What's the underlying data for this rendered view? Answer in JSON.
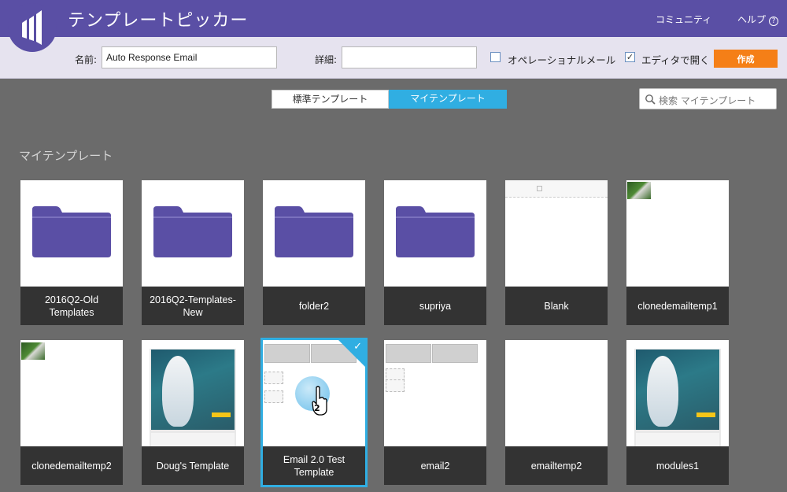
{
  "header": {
    "title": "テンプレートピッカー",
    "community_label": "コミュニティ",
    "help_label": "ヘルプ",
    "help_icon_glyph": "?"
  },
  "form": {
    "name_label": "名前:",
    "name_value": "Auto Response Email",
    "details_label": "詳細:",
    "details_value": "",
    "operational_label": "オペレーショナルメール",
    "operational_checked": false,
    "open_editor_label": "エディタで開く",
    "open_editor_checked": true,
    "checkbox_checked_glyph": "✓",
    "create_label": "作成"
  },
  "tabs": [
    {
      "label": "標準テンプレート",
      "active": false
    },
    {
      "label": "マイテンプレート",
      "active": true
    }
  ],
  "search": {
    "placeholder": "検索 マイテンプレート"
  },
  "section_title": "マイテンプレート",
  "cards": [
    {
      "label": "2016Q2-Old Templates",
      "kind": "folder-icon"
    },
    {
      "label": "2016Q2-Templates-New",
      "kind": "folder-icon"
    },
    {
      "label": "folder2",
      "kind": "folder-icon"
    },
    {
      "label": "supriya",
      "kind": "folder-icon"
    },
    {
      "label": "Blank",
      "kind": "blank-template"
    },
    {
      "label": "clonedemailtemp1",
      "kind": "photo-thumbnail"
    },
    {
      "label": "clonedemailtemp2",
      "kind": "photo-thumbnail"
    },
    {
      "label": "Doug's Template",
      "kind": "email-preview"
    },
    {
      "label": "Email 2.0 Test Template",
      "kind": "image-blocks",
      "selected": true,
      "check_glyph": "✓"
    },
    {
      "label": "email2",
      "kind": "image-blocks"
    },
    {
      "label": "emailtemp2",
      "kind": "blank-template"
    },
    {
      "label": "modules1",
      "kind": "email-preview"
    }
  ],
  "cursor": {
    "click_count": "2"
  },
  "colors": {
    "header_bg": "#5a4fa5",
    "folder": "#5a4fa5",
    "accent": "#30aee2",
    "create_button": "#f57f17"
  }
}
